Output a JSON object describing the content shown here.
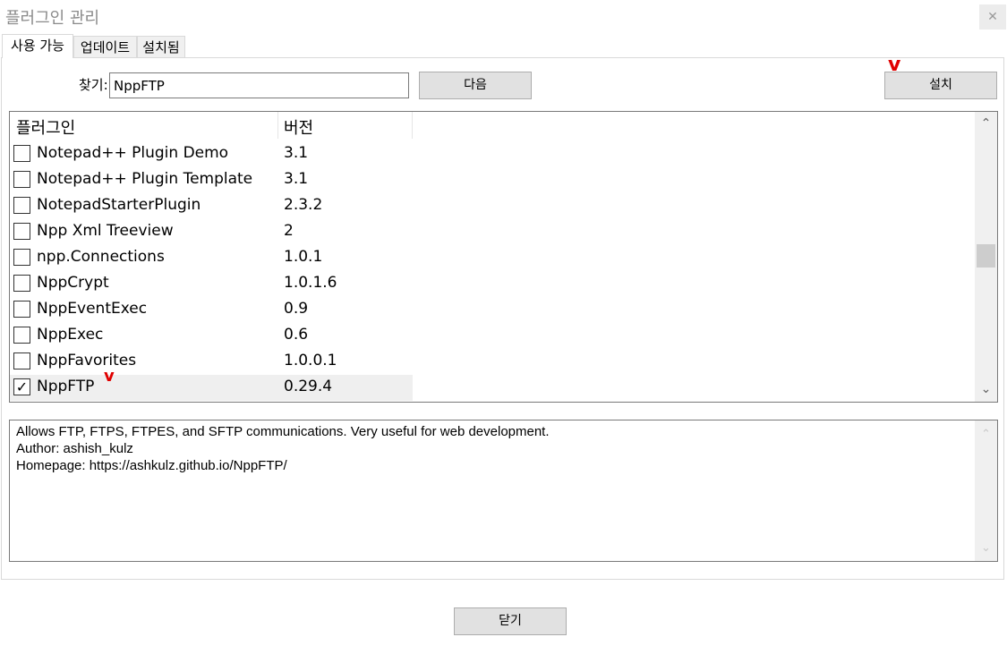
{
  "window": {
    "title": "플러그인 관리",
    "close_glyph": "✕"
  },
  "tabs": [
    {
      "label": "사용 가능",
      "active": true
    },
    {
      "label": "업데이트",
      "active": false
    },
    {
      "label": "설치됨",
      "active": false
    }
  ],
  "search": {
    "label": "찾기:",
    "value": "NppFTP"
  },
  "buttons": {
    "next": "다음",
    "install": "설치",
    "close": "닫기"
  },
  "plugin_list": {
    "columns": [
      "플러그인",
      "버전"
    ],
    "rows": [
      {
        "name": "Notepad++ Plugin Demo",
        "version": "3.1",
        "checked": false
      },
      {
        "name": "Notepad++ Plugin Template",
        "version": "3.1",
        "checked": false
      },
      {
        "name": "NotepadStarterPlugin",
        "version": "2.3.2",
        "checked": false
      },
      {
        "name": "Npp Xml Treeview",
        "version": "2",
        "checked": false
      },
      {
        "name": "npp.Connections",
        "version": "1.0.1",
        "checked": false
      },
      {
        "name": "NppCrypt",
        "version": "1.0.1.6",
        "checked": false
      },
      {
        "name": "NppEventExec",
        "version": "0.9",
        "checked": false
      },
      {
        "name": "NppExec",
        "version": "0.6",
        "checked": false
      },
      {
        "name": "NppFavorites",
        "version": "1.0.0.1",
        "checked": false
      },
      {
        "name": "NppFTP",
        "version": "0.29.4",
        "checked": true
      }
    ]
  },
  "description": {
    "lines": [
      "Allows FTP, FTPS, FTPES, and SFTP communications. Very useful for web development.",
      "Author: ashish_kulz",
      "Homepage: https://ashkulz.github.io/NppFTP/"
    ]
  },
  "scroll_glyphs": {
    "up": "⌃",
    "down": "⌄"
  },
  "annotation_mark": "v",
  "colors": {
    "annotation": "#e00000",
    "button_bg": "#e1e1e1",
    "selected_row": "#efefef"
  }
}
